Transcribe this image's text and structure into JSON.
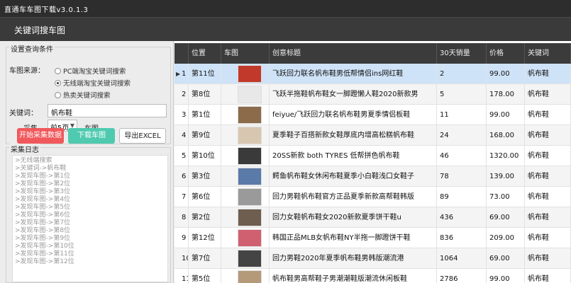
{
  "app": {
    "title": "直通车车图下载v3.0.1.3",
    "tab": "关键词搜车图"
  },
  "settings": {
    "group_label": "设置查询条件",
    "source_label": "车图来源：",
    "sources": [
      {
        "label": "PC端淘宝关键词搜索",
        "selected": false
      },
      {
        "label": "无线端淘宝关键词搜索",
        "selected": true
      },
      {
        "label": "热卖关键词搜索",
        "selected": false
      }
    ],
    "keyword_label": "关键词：",
    "keyword_value": "帆布鞋",
    "collect_label": "采集",
    "pages_value": "前5页",
    "pages_suffix": "车图",
    "btn_start": "开始采集数据",
    "btn_download": "下载车图",
    "btn_export": "导出EXCEL"
  },
  "log": {
    "label": "采集日志",
    "lines": [
      ">无线端搜索",
      ">关键词->帆布鞋",
      ">发现车图->第1位",
      ">发现车图->第2位",
      ">发现车图->第3位",
      ">发现车图->第4位",
      ">发现车图->第5位",
      ">发现车图->第6位",
      ">发现车图->第7位",
      ">发现车图->第8位",
      ">发现车图->第9位",
      ">发现车图->第10位",
      ">发现车图->第11位",
      ">发现车图->第12位"
    ]
  },
  "table": {
    "columns": [
      "",
      "位置",
      "车图",
      "创意标题",
      "30天销量",
      "价格",
      "关键词"
    ],
    "rows": [
      {
        "n": "1",
        "pos": "第11位",
        "title": "飞跃回力联名帆布鞋男低帮情侣ins网红鞋",
        "sales": "2",
        "price": "99.00",
        "kw": "帆布鞋"
      },
      {
        "n": "2",
        "pos": "第8位",
        "title": "飞跃半拖鞋帆布鞋女一脚蹬懒人鞋2020新款男",
        "sales": "5",
        "price": "178.00",
        "kw": "帆布鞋"
      },
      {
        "n": "3",
        "pos": "第1位",
        "title": "feiyue/飞跃回力联名帆布鞋男夏季情侣板鞋",
        "sales": "11",
        "price": "99.00",
        "kw": "帆布鞋"
      },
      {
        "n": "4",
        "pos": "第9位",
        "title": "夏季鞋子百搭新款女鞋厚底内增高松糕帆布鞋",
        "sales": "24",
        "price": "168.00",
        "kw": "帆布鞋"
      },
      {
        "n": "5",
        "pos": "第10位",
        "title": "20SS新款 both TYRES 低帮拼色帆布鞋",
        "sales": "46",
        "price": "1320.00",
        "kw": "帆布鞋"
      },
      {
        "n": "6",
        "pos": "第3位",
        "title": "鳄鱼帆布鞋女休闲布鞋夏季小白鞋浅口女鞋子",
        "sales": "78",
        "price": "139.00",
        "kw": "帆布鞋"
      },
      {
        "n": "7",
        "pos": "第6位",
        "title": "回力男鞋帆布鞋官方正品夏季新款高帮鞋韩版",
        "sales": "89",
        "price": "73.00",
        "kw": "帆布鞋"
      },
      {
        "n": "8",
        "pos": "第2位",
        "title": "回力女鞋帆布鞋女2020新款夏季饼干鞋u",
        "sales": "436",
        "price": "69.00",
        "kw": "帆布鞋"
      },
      {
        "n": "9",
        "pos": "第12位",
        "title": "韩国正品MLB女帆布鞋NY半拖一脚蹬饼干鞋",
        "sales": "836",
        "price": "209.00",
        "kw": "帆布鞋"
      },
      {
        "n": "10",
        "pos": "第7位",
        "title": "回力男鞋2020年夏季帆布鞋男韩版潮流港",
        "sales": "1064",
        "price": "69.00",
        "kw": "帆布鞋"
      },
      {
        "n": "11",
        "pos": "第5位",
        "title": "帆布鞋男高帮鞋子男潮潮鞋版潮流休闲板鞋",
        "sales": "2786",
        "price": "99.00",
        "kw": "帆布鞋"
      }
    ],
    "thumb_colors": [
      "#c0392b",
      "#e8e8e8",
      "#8b6b4a",
      "#d8c7b0",
      "#3a3a3a",
      "#5a7aa8",
      "#9a9a9a",
      "#6e5e50",
      "#d06070",
      "#444",
      "#b59a7a"
    ]
  }
}
